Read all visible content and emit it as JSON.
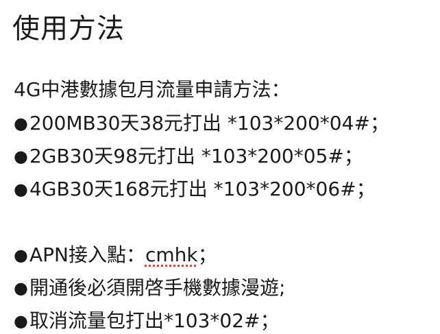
{
  "heading": "使用方法",
  "intro": "4G中港數據包月流量申請方法：",
  "bullet_symbol": "●",
  "plans": [
    {
      "text": "200MB30天38元打出 *103*200*04#；"
    },
    {
      "text": "2GB30天98元打出 *103*200*05#；"
    },
    {
      "text": "4GB30天168元打出 *103*200*06#；"
    }
  ],
  "apn": {
    "label": "APN接入點：",
    "value": "cmhk",
    "suffix": "；"
  },
  "roaming_note": "開通後必須開啓手機數據漫遊;",
  "cancel_note": "取消流量包打出*103*02#；",
  "colors": {
    "text": "#1a1a1a",
    "spellcheck_underline": "#e03a3a",
    "background": "#ffffff"
  }
}
